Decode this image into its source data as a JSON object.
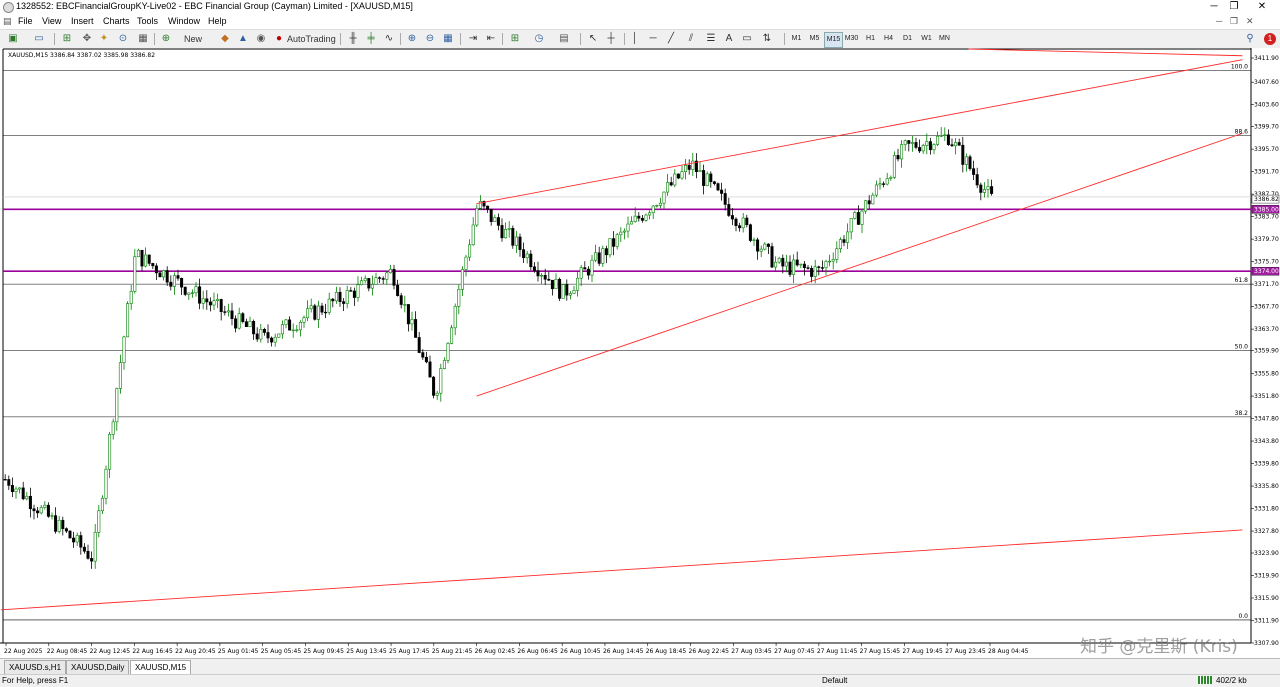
{
  "window": {
    "title": "1328552: EBCFinancialGroupKY-Live02 - EBC Financial Group (Cayman) Limited - [XAUUSD,M15]",
    "minimize": "─",
    "maximize": "❐",
    "close": "✕"
  },
  "menu": [
    "File",
    "View",
    "Insert",
    "Charts",
    "Tools",
    "Window",
    "Help"
  ],
  "toolbar": {
    "new_order": "New Order",
    "autotrading": "AutoTrading",
    "timeframes": [
      "M1",
      "M5",
      "M15",
      "M30",
      "H1",
      "H4",
      "D1",
      "W1",
      "MN"
    ],
    "text_tool": "A"
  },
  "chart": {
    "header": "XAUUSD,M15  3386.84 3387.02 3385.98 3386.82",
    "watermark": "知乎 @克里斯 (Kris)",
    "fib_labels": [
      {
        "label": "100.0",
        "price": 3409.7
      },
      {
        "label": "88.6",
        "price": 3398.1
      },
      {
        "label": "61.8",
        "price": 3371.7
      },
      {
        "label": "50.0",
        "price": 3359.9
      },
      {
        "label": "38.2",
        "price": 3348.1
      },
      {
        "label": "0.0",
        "price": 3312.0
      }
    ],
    "price_axis": [
      "3411.90",
      "3407.60",
      "3403.60",
      "3399.70",
      "3395.70",
      "3391.70",
      "3387.70",
      "3383.70",
      "3379.70",
      "3375.70",
      "3371.70",
      "3367.70",
      "3363.70",
      "3359.90",
      "3355.80",
      "3351.80",
      "3347.80",
      "3343.80",
      "3339.80",
      "3335.80",
      "3331.80",
      "3327.80",
      "3323.90",
      "3319.90",
      "3315.90",
      "3311.90",
      "3307.90"
    ],
    "price_tags": [
      {
        "text": "3386.82",
        "price": 3386.82,
        "color": "#000000",
        "bg": "#ffffff"
      },
      {
        "text": "3385.00",
        "price": 3385.0,
        "color": "#ffffff",
        "bg": "#a020a0"
      },
      {
        "text": "3374.00",
        "price": 3374.0,
        "color": "#ffffff",
        "bg": "#a020a0"
      }
    ],
    "time_axis": [
      "22 Aug 2025",
      "22 Aug 08:45",
      "22 Aug 12:45",
      "22 Aug 16:45",
      "22 Aug 20:45",
      "25 Aug 01:45",
      "25 Aug 05:45",
      "25 Aug 09:45",
      "25 Aug 13:45",
      "25 Aug 17:45",
      "25 Aug 21:45",
      "26 Aug 02:45",
      "26 Aug 06:45",
      "26 Aug 10:45",
      "26 Aug 14:45",
      "26 Aug 18:45",
      "26 Aug 22:45",
      "27 Aug 03:45",
      "27 Aug 07:45",
      "27 Aug 11:45",
      "27 Aug 15:45",
      "27 Aug 19:45",
      "27 Aug 23:45",
      "28 Aug 04:45"
    ],
    "colors": {
      "bull": "#008000",
      "bear": "#000000",
      "trend": "#ff2a2a",
      "hline": "#9b009b",
      "fib": "#000000"
    }
  },
  "chart_data": {
    "type": "candlestick",
    "title": "XAUUSD,M15",
    "ylim": [
      3307.9,
      3413.5
    ],
    "key_points": [
      {
        "time": "22 Aug 2025",
        "price": 3337
      },
      {
        "time": "22 Aug 12:45",
        "price": 3323
      },
      {
        "time": "22 Aug 16:45",
        "price": 3377
      },
      {
        "time": "25 Aug 05:45",
        "price": 3362
      },
      {
        "time": "25 Aug 17:45",
        "price": 3374
      },
      {
        "time": "25 Aug 21:45",
        "price": 3352
      },
      {
        "time": "26 Aug 02:45",
        "price": 3386
      },
      {
        "time": "26 Aug 10:45",
        "price": 3370
      },
      {
        "time": "26 Aug 22:45",
        "price": 3393
      },
      {
        "time": "27 Aug 07:45",
        "price": 3375
      },
      {
        "time": "27 Aug 11:45",
        "price": 3374
      },
      {
        "time": "27 Aug 19:45",
        "price": 3396
      },
      {
        "time": "27 Aug 23:45",
        "price": 3398
      },
      {
        "time": "28 Aug 04:45",
        "price": 3386.82
      }
    ],
    "horizontal_levels": [
      3385.0,
      3374.0
    ]
  },
  "tabs": [
    "XAUUSD.s,H1",
    "XAUUSD,Daily",
    "XAUUSD,M15"
  ],
  "active_tab": 2,
  "status": {
    "help": "For Help, press F1",
    "profile": "Default",
    "traffic": "402/2 kb"
  }
}
